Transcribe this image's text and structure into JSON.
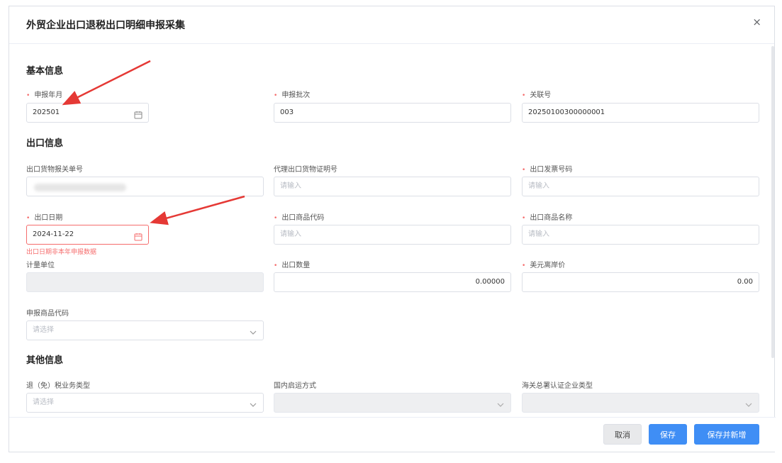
{
  "dialog": {
    "title": "外贸企业出口退税出口明细申报采集",
    "close_label": "×"
  },
  "sections": {
    "basic": "基本信息",
    "export": "出口信息",
    "other": "其他信息"
  },
  "fields": {
    "declare_month": {
      "label": "申报年月",
      "value": "202501"
    },
    "declare_batch": {
      "label": "申报批次",
      "value": "003"
    },
    "association_no": {
      "label": "关联号",
      "value": "20250100300000001"
    },
    "customs_declaration_no": {
      "label": "出口货物报关单号",
      "value": ""
    },
    "agent_export_cert_no": {
      "label": "代理出口货物证明号",
      "placeholder": "请输入"
    },
    "export_invoice_no": {
      "label": "出口发票号码",
      "placeholder": "请输入"
    },
    "export_date": {
      "label": "出口日期",
      "value": "2024-11-22",
      "error": "出口日期非本年申报数据"
    },
    "export_goods_code": {
      "label": "出口商品代码",
      "placeholder": "请输入"
    },
    "export_goods_name": {
      "label": "出口商品名称",
      "placeholder": "请输入"
    },
    "unit": {
      "label": "计量单位",
      "value": ""
    },
    "export_quantity": {
      "label": "出口数量",
      "value": "0.00000"
    },
    "usd_fob_price": {
      "label": "美元离岸价",
      "value": "0.00"
    },
    "declare_goods_code": {
      "label": "申报商品代码",
      "placeholder": "请选择"
    },
    "refund_business_type": {
      "label": "退（免）税业务类型",
      "placeholder": "请选择"
    },
    "domestic_transport": {
      "label": "国内启运方式",
      "value": ""
    },
    "customs_cert_type": {
      "label": "海关总署认证企业类型",
      "value": ""
    }
  },
  "footer": {
    "cancel": "取消",
    "save": "保存",
    "save_new": "保存并新增"
  },
  "colors": {
    "primary": "#3f8ef5",
    "error": "#f56c6c",
    "arrow": "#e53935"
  },
  "icons": {
    "calendar": "calendar-icon",
    "dropdown": "chevron-down-icon",
    "close": "close-icon"
  }
}
